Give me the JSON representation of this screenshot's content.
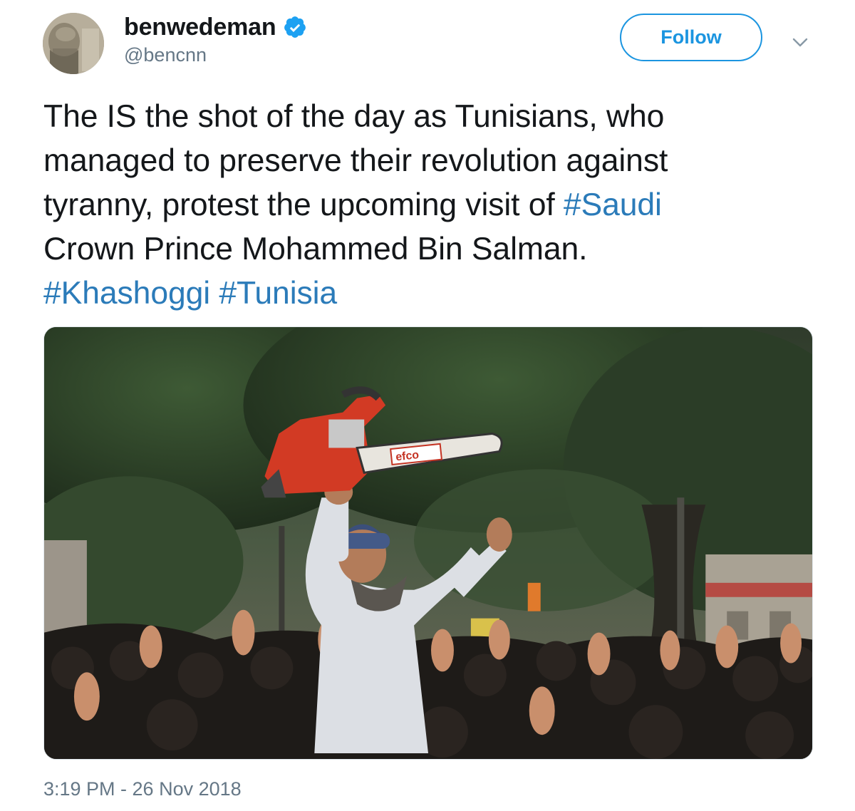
{
  "header": {
    "display_name": "benwedeman",
    "handle": "@bencnn",
    "verified": true,
    "follow_label": "Follow",
    "caret_icon": "chevron-down-icon"
  },
  "tweet": {
    "line1_a": "The IS the shot of the day as Tunisians, who",
    "line2_a": "managed to preserve their revolution against",
    "line3_a": "tyranny, protest the upcoming visit of ",
    "line3_tag": "#Saudi",
    "line4_a": "Crown Prince Mohammed Bin Salman.",
    "line5_tag1": "#Khashoggi",
    "line5_sep": " ",
    "line5_tag2": "#Tunisia"
  },
  "media": {
    "saw_brand": "efco"
  },
  "timestamp": "3:19 PM - 26 Nov 2018",
  "colors": {
    "link": "#2b7bb9",
    "follow": "#1b95e0",
    "secondary": "#657786",
    "verified": "#1da1f2"
  }
}
